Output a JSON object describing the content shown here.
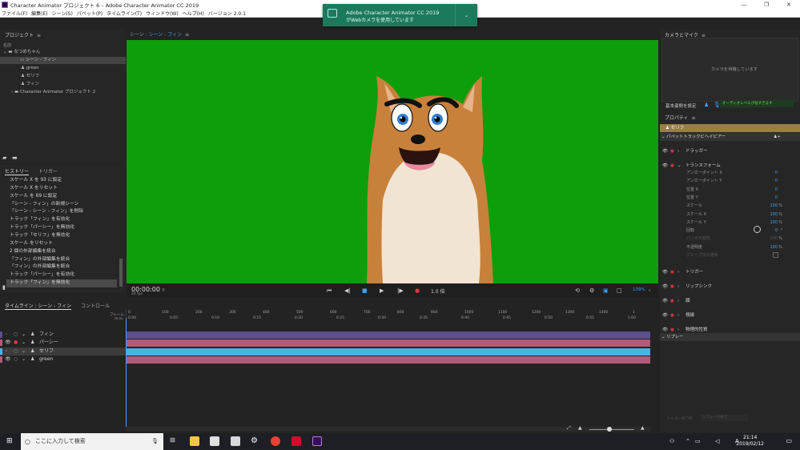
{
  "window": {
    "title": "Character Animator プロジェクト 6 – Adobe Character Animator CC 2019",
    "controls": [
      "—",
      "❐",
      "✕"
    ]
  },
  "menu": [
    "ファイル(F)",
    "編集(E)",
    "シーン(S)",
    "パペット(P)",
    "タイムライン(T)",
    "ウィンドウ(W)",
    "ヘルプ(H)",
    "バージョン 2.0.1"
  ],
  "toast": {
    "title": "Adobe Character Animator CC 2019",
    "message": "がWebカメラを使用しています"
  },
  "project": {
    "title": "プロジェクト",
    "col": "名前",
    "root": "なつめちゃん",
    "items": [
      "シーン - フィン",
      "green",
      "セリフ",
      "フィン"
    ],
    "folder": "Character Animator プロジェクト 2"
  },
  "history": {
    "tabs": [
      "ヒストリー",
      "トリガー"
    ],
    "items": [
      "スケール X を 93 に設定",
      "スケール X をリセット",
      "スケール を 69 に設定",
      "「シーン - フィン」の新規シーン",
      "「シーン - シーン - フィン」を削除",
      "トラック「フィン」を有効化",
      "トラック「パーシー」を無効化",
      "トラック「セリフ」を無効化",
      "スケール をリセット",
      "2 個の外部編集を統合",
      "「フィン」の外部編集を統合",
      "「フィン」の外部編集を統合",
      "トラック「パーシー」を有効化",
      "トラック「フィン」を無効化"
    ]
  },
  "stage": {
    "label": "シーン :",
    "scene": "シーン - フィン",
    "bg": "#0d9e0b"
  },
  "transport": {
    "time": "00:00:00",
    "time_sub": "0",
    "fps": "24 fps",
    "rate": "1.0 倍",
    "zoom": "139%"
  },
  "timeline": {
    "tabs": [
      "タイムライン : シーン - フィン",
      "コントロール"
    ],
    "frame_label": "フレーム",
    "time_label": "m:ss",
    "frames": [
      "0",
      "100",
      "200",
      "300",
      "400",
      "500",
      "600",
      "700",
      "800",
      "900",
      "1000",
      "1100",
      "1200",
      "1300",
      "1400",
      "1"
    ],
    "times": [
      "0:00",
      "0:05",
      "0:10",
      "0:15",
      "0:20",
      "0:25",
      "0:30",
      "0:35",
      "0:40",
      "0:45",
      "0:50",
      "0:55",
      "1:00"
    ],
    "tracks": [
      {
        "name": "フィン",
        "color": "#5c4f8d"
      },
      {
        "name": "パーシー",
        "color": "#b35a78"
      },
      {
        "name": "セリフ",
        "color": "#47b3e8"
      },
      {
        "name": "green",
        "color": "#b35a78"
      }
    ]
  },
  "camera": {
    "title": "カメラとマイク",
    "waiting": "カメラを待機しています",
    "set_pose": "基本姿勢を設定",
    "audio": "オーディオレベルが低すぎます"
  },
  "properties": {
    "title": "プロパティ",
    "selected": "セリフ",
    "puppet_track": "パペットトラックビヘイビアー",
    "sections": [
      "ドラッガー",
      "トランスフォーム",
      "トリガー",
      "リップシンク",
      "顔",
      "視線",
      "物理的性質"
    ],
    "transform": [
      {
        "n": "アンカーポイント X",
        "v": "0",
        "u": ""
      },
      {
        "n": "アンカーポイント Y",
        "v": "0",
        "u": ""
      },
      {
        "n": "位置 X",
        "v": "0",
        "u": ""
      },
      {
        "n": "位置 Y",
        "v": "0",
        "u": ""
      },
      {
        "n": "スケール",
        "v": "100",
        "u": "%"
      },
      {
        "n": "スケール X",
        "v": "100",
        "u": "%"
      },
      {
        "n": "スケール Y",
        "v": "100",
        "u": "%"
      },
      {
        "n": "回転",
        "v": "0",
        "u": "°"
      },
      {
        "n": "パンの可視性",
        "v": "100",
        "u": "%"
      },
      {
        "n": "不透明度",
        "v": "100",
        "u": "%"
      },
      {
        "n": "グループ化の適用",
        "v": "",
        "u": ""
      }
    ],
    "replays": "リプレー",
    "trigger_end": "トリガー終了時",
    "trigger_end_val": "リプレーを終了"
  },
  "taskbar": {
    "search": "ここに入力して検索",
    "time": "21:14",
    "date": "2019/02/12"
  }
}
